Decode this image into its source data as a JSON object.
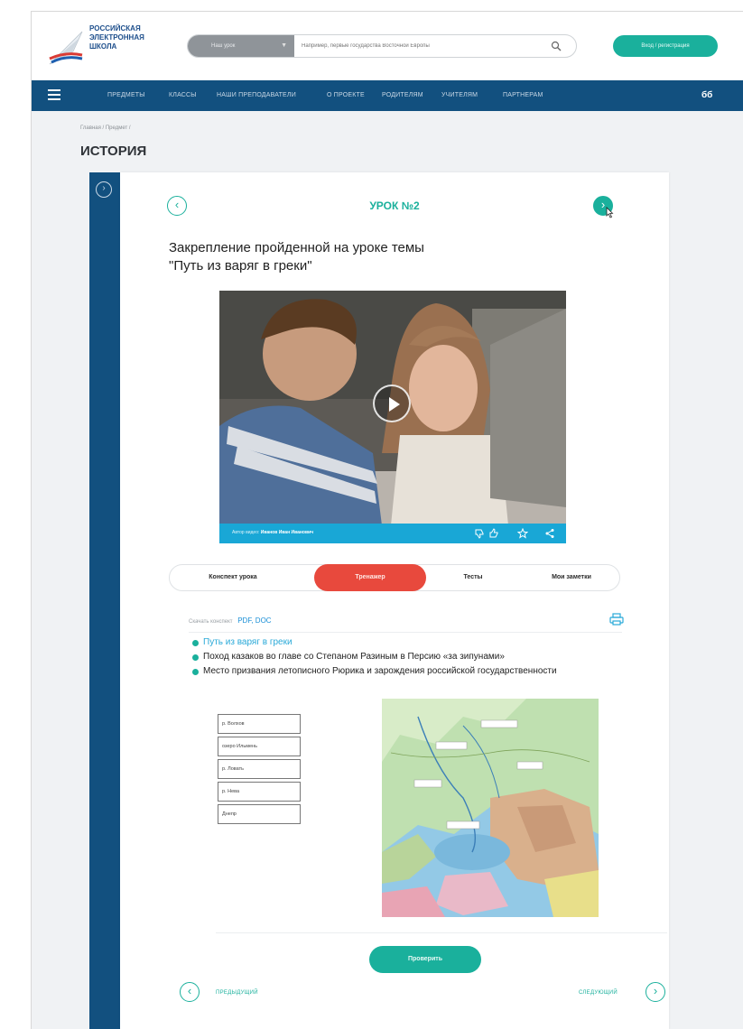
{
  "logo": {
    "line1": "РОССИЙСКАЯ",
    "line2": "ЭЛЕКТРОННАЯ",
    "line3": "ШКОЛА"
  },
  "search": {
    "category": "Наш урок",
    "placeholder": "Например, первые государства Восточной Европы"
  },
  "header": {
    "login_label": "Вход / регистрация"
  },
  "nav": {
    "items": [
      "ПРЕДМЕТЫ",
      "КЛАССЫ",
      "НАШИ ПРЕПОДАВАТЕЛИ",
      "О ПРОЕКТЕ",
      "РОДИТЕЛЯМ",
      "УЧИТЕЛЯМ",
      "ПАРТНЕРАМ"
    ],
    "accessibility": "бб"
  },
  "breadcrumb": "Главная / Предмет /",
  "page_title": "ИСТОРИЯ",
  "lesson": {
    "number": "УРОК №2",
    "title_line1": "Закрепление пройденной на уроке темы",
    "title_line2": "\"Путь из варяг в греки\""
  },
  "video": {
    "author_prefix": "Автор видео:",
    "author_name": "Иванов Иван Иванович"
  },
  "tabs": [
    "Конспект урока",
    "Тренажер",
    "Тесты",
    "Мои заметки"
  ],
  "active_tab": "Тренажер",
  "download": {
    "label": "Скачать конспект",
    "pdf": "PDF",
    "doc": "DOC"
  },
  "bullets": [
    "Путь из варяг в греки",
    "Поход казаков во главе со Степаном Разиным в Персию «за зипунами»",
    "Место призвания летописного Рюрика и зарождения российской государственности"
  ],
  "terms": [
    "р. Волхов",
    "озеро Ильмень",
    "р. Ловать",
    "р. Нева",
    "Днепр"
  ],
  "buttons": {
    "check": "Проверить",
    "prev": "ПРЕДЫДУЩИЙ",
    "next": "СЛЕДУЮЩИЙ"
  },
  "colors": {
    "accent": "#1ab09c",
    "nav": "#12507f",
    "active_tab": "#e8493d",
    "video_bar": "#19a7d6"
  }
}
